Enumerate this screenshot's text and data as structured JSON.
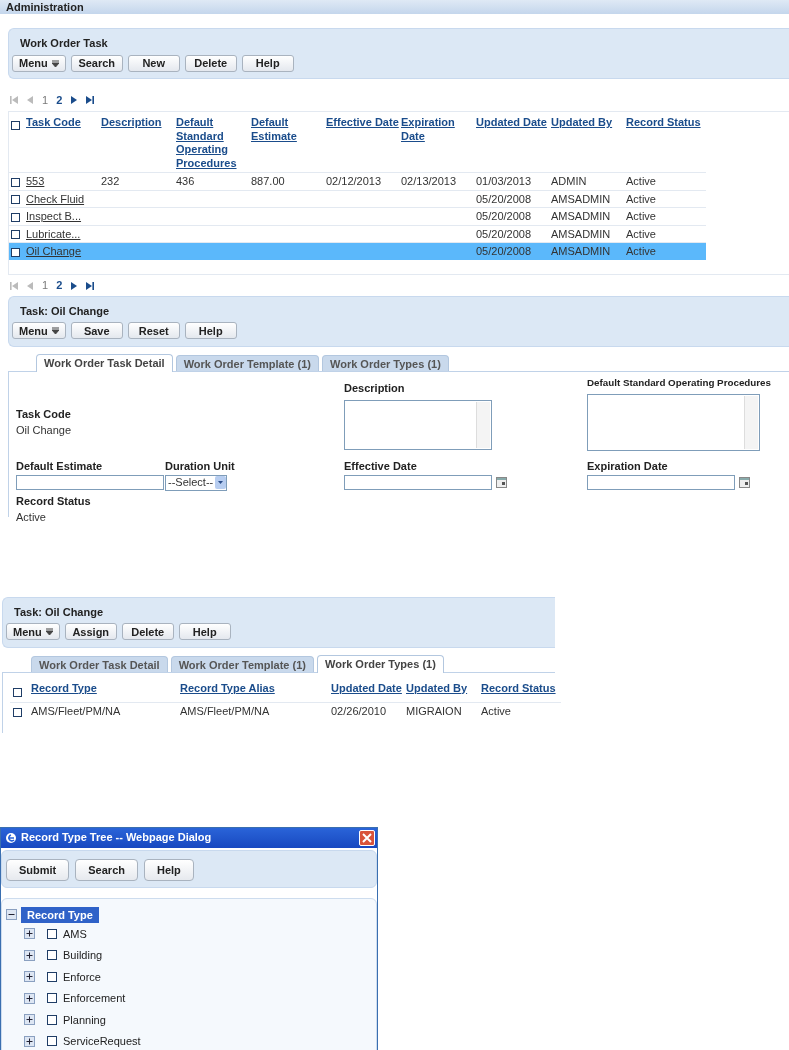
{
  "header": {
    "title": "Administration"
  },
  "list_panel": {
    "title": "Work Order Task",
    "buttons": [
      {
        "label": "Menu",
        "kind": "menu"
      },
      {
        "label": "Search",
        "kind": "plain"
      },
      {
        "label": "New",
        "kind": "plain"
      },
      {
        "label": "Delete",
        "kind": "plain"
      },
      {
        "label": "Help",
        "kind": "plain"
      }
    ]
  },
  "pager_top": {
    "at_start": true,
    "pages": [
      {
        "label": "1",
        "selected": true
      },
      {
        "label": "2",
        "selected": false
      }
    ]
  },
  "task_table": {
    "all_checked": false,
    "columns": [
      "Task Code",
      "Description",
      "Default Standard Operating Procedures",
      "Default Estimate",
      "Effective Date",
      "Expiration Date",
      "Updated Date",
      "Updated By",
      "Record Status"
    ],
    "rows": [
      {
        "selected": false,
        "checked": false,
        "cells": [
          "553",
          "232",
          "436",
          "887.00",
          "02/12/2013",
          "02/13/2013",
          "01/03/2013",
          "ADMIN",
          "Active"
        ]
      },
      {
        "selected": false,
        "checked": false,
        "cells": [
          "Check Fluid",
          null,
          null,
          null,
          null,
          null,
          "05/20/2008",
          "AMSADMIN",
          "Active"
        ]
      },
      {
        "selected": false,
        "checked": false,
        "cells": [
          "Inspect B...",
          null,
          null,
          null,
          null,
          null,
          "05/20/2008",
          "AMSADMIN",
          "Active"
        ]
      },
      {
        "selected": false,
        "checked": false,
        "cells": [
          "Lubricate...",
          null,
          null,
          null,
          null,
          null,
          "05/20/2008",
          "AMSADMIN",
          "Active"
        ]
      },
      {
        "selected": true,
        "checked": false,
        "cells": [
          "Oil Change",
          null,
          null,
          null,
          null,
          null,
          "05/20/2008",
          "AMSADMIN",
          "Active"
        ]
      }
    ]
  },
  "pager_bottom": {
    "at_start": true,
    "pages": [
      {
        "label": "1",
        "selected": true
      },
      {
        "label": "2",
        "selected": false
      }
    ]
  },
  "detail_panel": {
    "title": "Task: Oil Change",
    "buttons": [
      {
        "label": "Menu",
        "kind": "menu"
      },
      {
        "label": "Save",
        "kind": "plain"
      },
      {
        "label": "Reset",
        "kind": "plain"
      },
      {
        "label": "Help",
        "kind": "plain"
      }
    ]
  },
  "detail_tabs": [
    {
      "label": "Work Order Task Detail",
      "selected": true
    },
    {
      "label": "Work Order Template (1)",
      "selected": false
    },
    {
      "label": "Work Order Types (1)",
      "selected": false
    }
  ],
  "detail_form": {
    "task_code": {
      "label": "Task Code",
      "value": "Oil Change"
    },
    "description": {
      "label": "Description"
    },
    "sop": {
      "label": "Default Standard Operating Procedures"
    },
    "default_estimate": {
      "label": "Default Estimate"
    },
    "duration_unit": {
      "label": "Duration Unit",
      "value": "--Select--"
    },
    "effective_date": {
      "label": "Effective Date"
    },
    "expiration_date": {
      "label": "Expiration Date"
    },
    "record_status": {
      "label": "Record Status",
      "value": "Active"
    }
  },
  "types_panel": {
    "title": "Task: Oil Change",
    "buttons": [
      {
        "label": "Menu",
        "kind": "menu"
      },
      {
        "label": "Assign",
        "kind": "plain"
      },
      {
        "label": "Delete",
        "kind": "plain"
      },
      {
        "label": "Help",
        "kind": "plain"
      }
    ]
  },
  "types_tabs": [
    {
      "label": "Work Order Task Detail",
      "selected": false
    },
    {
      "label": "Work Order Template (1)",
      "selected": false
    },
    {
      "label": "Work Order Types (1)",
      "selected": true
    }
  ],
  "types_table": {
    "all_checked": false,
    "columns": [
      "Record Type",
      "Record Type Alias",
      "Updated Date",
      "Updated By",
      "Record Status"
    ],
    "rows": [
      {
        "checked": false,
        "cells": [
          "AMS/Fleet/PM/NA",
          "AMS/Fleet/PM/NA",
          "02/26/2010",
          "MIGRAION",
          "Active"
        ]
      }
    ]
  },
  "dialog": {
    "title": "Record Type Tree -- Webpage Dialog",
    "buttons": [
      "Submit",
      "Search",
      "Help"
    ],
    "tree": {
      "label": "Record Type",
      "expanded": true,
      "selected": true,
      "children": [
        {
          "label": "AMS",
          "expanded": false,
          "checked": false
        },
        {
          "label": "Building",
          "expanded": false,
          "checked": false
        },
        {
          "label": "Enforce",
          "expanded": false,
          "checked": false
        },
        {
          "label": "Enforcement",
          "expanded": false,
          "checked": false
        },
        {
          "label": "Planning",
          "expanded": false,
          "checked": false
        },
        {
          "label": "ServiceRequest",
          "expanded": false,
          "checked": false
        }
      ]
    }
  }
}
